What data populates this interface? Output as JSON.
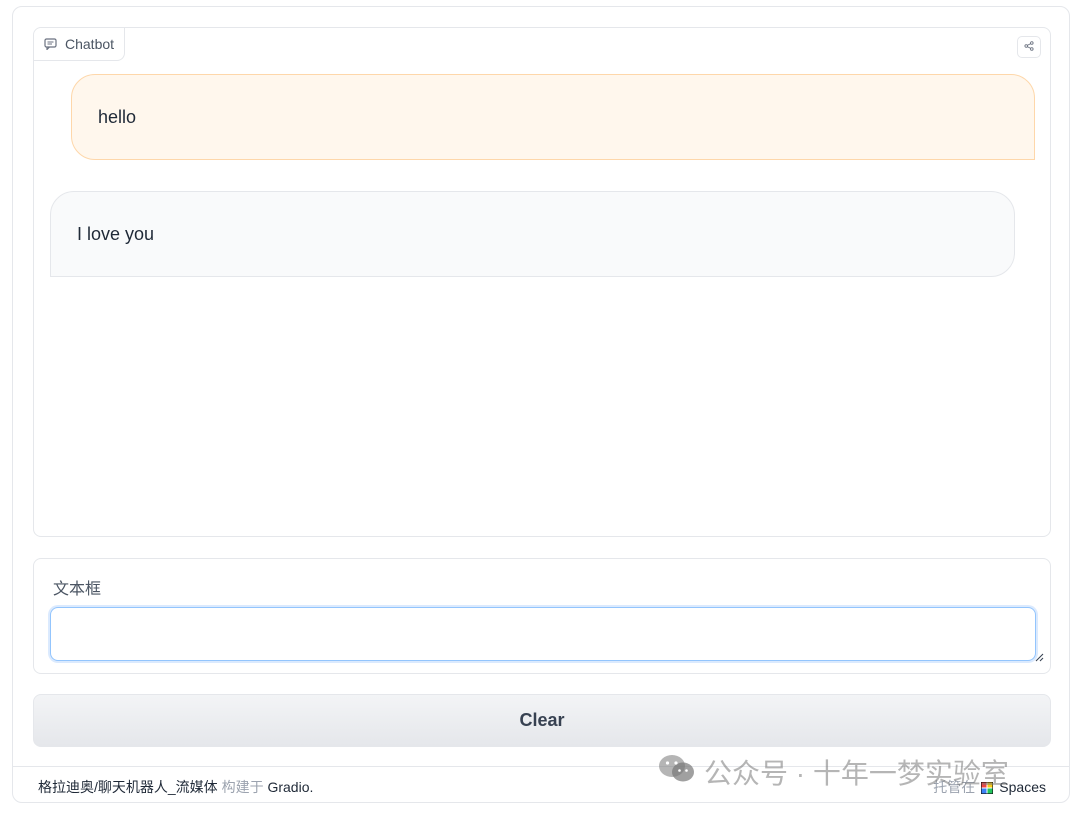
{
  "chatbot": {
    "label": "Chatbot",
    "icon": "chat-icon",
    "share_icon": "share-icon",
    "messages": [
      {
        "role": "user",
        "text": "hello"
      },
      {
        "role": "bot",
        "text": "I love you"
      }
    ]
  },
  "textbox": {
    "label": "文本框",
    "value": "",
    "placeholder": ""
  },
  "clear_button": {
    "label": "Clear"
  },
  "footer": {
    "app_path": "格拉迪奥/聊天机器人_流媒体",
    "built_with": "构建于",
    "gradio_link": "Gradio.",
    "hosted_on": "托管在",
    "spaces_link": "Spaces"
  },
  "watermark": {
    "icon": "wechat-icon",
    "text": "公众号 · 十年一梦实验室"
  },
  "colors": {
    "user_bubble_bg": "#fff7ed",
    "user_bubble_border": "#fed7aa",
    "bot_bubble_bg": "#f9fafb",
    "input_focus_border": "#93c5fd"
  }
}
